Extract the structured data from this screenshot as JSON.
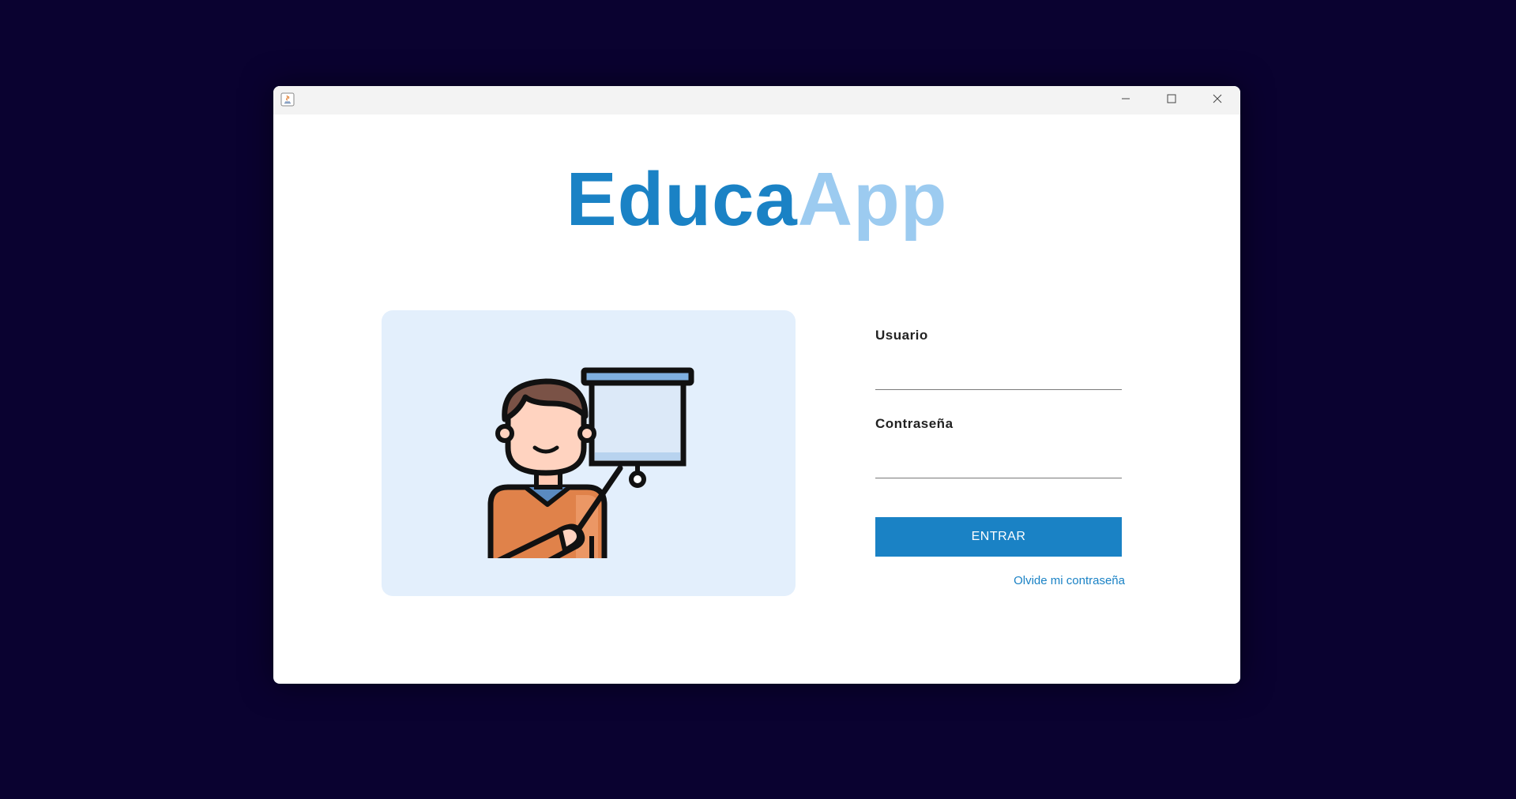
{
  "window": {
    "controls": {
      "minimize_icon": "minimize-icon",
      "maximize_icon": "maximize-icon",
      "close_icon": "close-icon"
    }
  },
  "logo": {
    "part1": "Educa",
    "part2": "App",
    "colors": {
      "part1": "#1a82c5",
      "part2": "#9ccbf0"
    }
  },
  "illustration": {
    "icon": "teacher-presentation-icon",
    "background": "#e3effc"
  },
  "form": {
    "username_label": "Usuario",
    "username_value": "",
    "password_label": "Contraseña",
    "password_value": "",
    "submit_label": "ENTRAR",
    "forgot_link": "Olvide mi contraseña"
  },
  "colors": {
    "background": "#0a0230",
    "accent": "#1a82c5"
  }
}
